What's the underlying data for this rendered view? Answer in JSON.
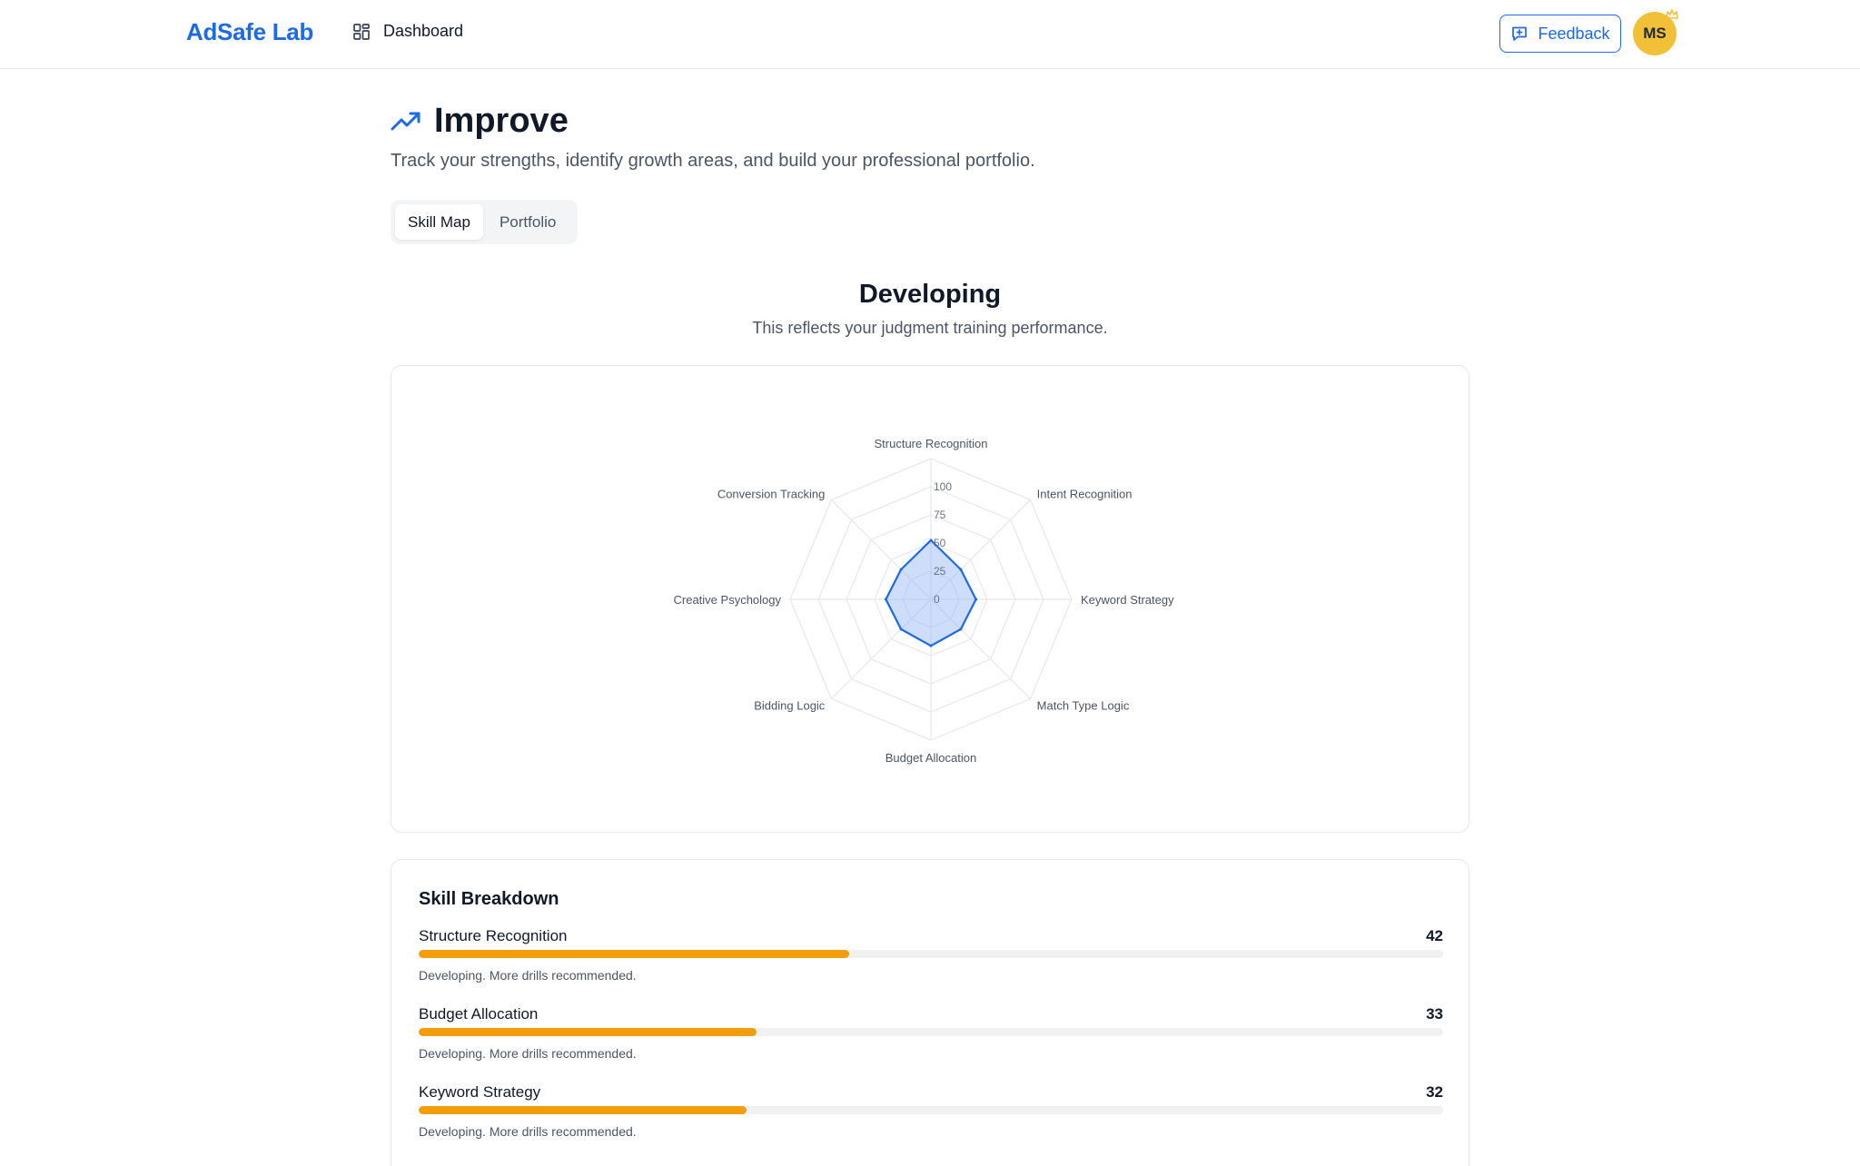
{
  "nav": {
    "brand": "AdSafe Lab",
    "dashboard_label": "Dashboard",
    "feedback_label": "Feedback",
    "avatar_initials": "MS"
  },
  "header": {
    "title": "Improve",
    "subtitle": "Track your strengths, identify growth areas, and build your professional portfolio."
  },
  "tabs": [
    {
      "label": "Skill Map",
      "active": true
    },
    {
      "label": "Portfolio",
      "active": false
    }
  ],
  "level": {
    "title": "Developing",
    "subtitle": "This reflects your judgment training performance."
  },
  "chart_data": {
    "type": "radar",
    "axes": [
      "Structure Recognition",
      "Intent Recognition",
      "Keyword Strategy",
      "Match Type Logic",
      "Budget Allocation",
      "Bidding Logic",
      "Creative Psychology",
      "Conversion Tracking"
    ],
    "values": [
      42,
      30,
      32,
      30,
      33,
      30,
      32,
      30
    ],
    "rlim": [
      0,
      100
    ],
    "ticks": [
      0,
      25,
      50,
      75,
      100
    ],
    "grid": true,
    "colors": {
      "fill": "#93b4f5",
      "stroke": "#1d6ae5",
      "grid": "#e5e7eb"
    }
  },
  "breakdown": {
    "title": "Skill Breakdown",
    "skills": [
      {
        "name": "Structure Recognition",
        "score": "42",
        "value": 42,
        "note": "Developing. More drills recommended."
      },
      {
        "name": "Budget Allocation",
        "score": "33",
        "value": 33,
        "note": "Developing. More drills recommended."
      },
      {
        "name": "Keyword Strategy",
        "score": "32",
        "value": 32,
        "note": "Developing. More drills recommended."
      }
    ]
  },
  "colors": {
    "accent": "#1d6ae5",
    "progress": "#f29d0c",
    "avatar": "#f2c037"
  }
}
